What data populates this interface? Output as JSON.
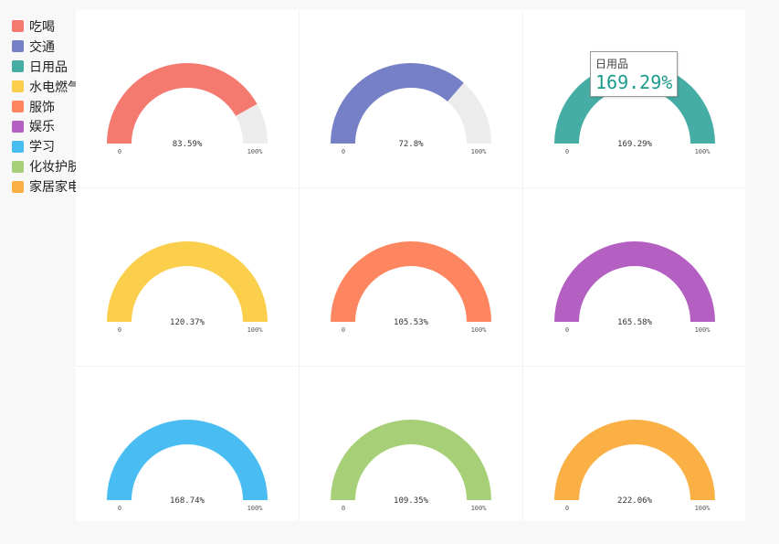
{
  "legend": [
    {
      "label": "吃喝",
      "color": "#f47a6f"
    },
    {
      "label": "交通",
      "color": "#7580c6"
    },
    {
      "label": "日用品",
      "color": "#46ada5"
    },
    {
      "label": "水电燃气",
      "color": "#fbcf4b"
    },
    {
      "label": "服饰",
      "color": "#fd8560"
    },
    {
      "label": "娱乐",
      "color": "#b460c2"
    },
    {
      "label": "学习",
      "color": "#49bdf1"
    },
    {
      "label": "化妆护肤",
      "color": "#a7cf77"
    },
    {
      "label": "家居家电",
      "color": "#fbb046"
    }
  ],
  "chart_data": {
    "type": "gauge",
    "axis_min_label": "0",
    "axis_max_label": "100%",
    "max": 100,
    "track_color": "#ececec",
    "series": [
      {
        "name": "吃喝",
        "value": 83.59,
        "label": "83.59%",
        "color": "#f47a6f"
      },
      {
        "name": "交通",
        "value": 72.8,
        "label": "72.8%",
        "color": "#7580c6"
      },
      {
        "name": "日用品",
        "value": 169.29,
        "label": "169.29%",
        "color": "#46ada5"
      },
      {
        "name": "水电燃气",
        "value": 120.37,
        "label": "120.37%",
        "color": "#fbcf4b"
      },
      {
        "name": "服饰",
        "value": 105.53,
        "label": "105.53%",
        "color": "#fd8560"
      },
      {
        "name": "娱乐",
        "value": 165.58,
        "label": "165.58%",
        "color": "#b460c2"
      },
      {
        "name": "学习",
        "value": 168.74,
        "label": "168.74%",
        "color": "#49bdf1"
      },
      {
        "name": "化妆护肤",
        "value": 109.35,
        "label": "109.35%",
        "color": "#a7cf77"
      },
      {
        "name": "家居家电",
        "value": 222.06,
        "label": "222.06%",
        "color": "#fbb046"
      }
    ]
  },
  "tooltip": {
    "title": "日用品",
    "value": "169.29%",
    "color": "#1b9b8c"
  }
}
